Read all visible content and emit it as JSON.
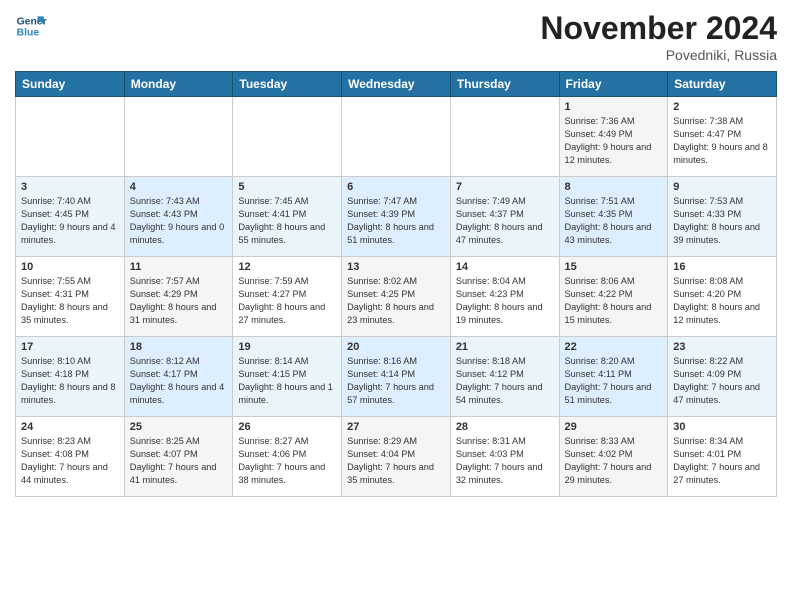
{
  "header": {
    "logo_line1": "General",
    "logo_line2": "Blue",
    "month": "November 2024",
    "location": "Povedniki, Russia"
  },
  "days_of_week": [
    "Sunday",
    "Monday",
    "Tuesday",
    "Wednesday",
    "Thursday",
    "Friday",
    "Saturday"
  ],
  "weeks": [
    [
      {
        "day": "",
        "info": ""
      },
      {
        "day": "",
        "info": ""
      },
      {
        "day": "",
        "info": ""
      },
      {
        "day": "",
        "info": ""
      },
      {
        "day": "",
        "info": ""
      },
      {
        "day": "1",
        "info": "Sunrise: 7:36 AM\nSunset: 4:49 PM\nDaylight: 9 hours and 12 minutes."
      },
      {
        "day": "2",
        "info": "Sunrise: 7:38 AM\nSunset: 4:47 PM\nDaylight: 9 hours and 8 minutes."
      }
    ],
    [
      {
        "day": "3",
        "info": "Sunrise: 7:40 AM\nSunset: 4:45 PM\nDaylight: 9 hours and 4 minutes."
      },
      {
        "day": "4",
        "info": "Sunrise: 7:43 AM\nSunset: 4:43 PM\nDaylight: 9 hours and 0 minutes."
      },
      {
        "day": "5",
        "info": "Sunrise: 7:45 AM\nSunset: 4:41 PM\nDaylight: 8 hours and 55 minutes."
      },
      {
        "day": "6",
        "info": "Sunrise: 7:47 AM\nSunset: 4:39 PM\nDaylight: 8 hours and 51 minutes."
      },
      {
        "day": "7",
        "info": "Sunrise: 7:49 AM\nSunset: 4:37 PM\nDaylight: 8 hours and 47 minutes."
      },
      {
        "day": "8",
        "info": "Sunrise: 7:51 AM\nSunset: 4:35 PM\nDaylight: 8 hours and 43 minutes."
      },
      {
        "day": "9",
        "info": "Sunrise: 7:53 AM\nSunset: 4:33 PM\nDaylight: 8 hours and 39 minutes."
      }
    ],
    [
      {
        "day": "10",
        "info": "Sunrise: 7:55 AM\nSunset: 4:31 PM\nDaylight: 8 hours and 35 minutes."
      },
      {
        "day": "11",
        "info": "Sunrise: 7:57 AM\nSunset: 4:29 PM\nDaylight: 8 hours and 31 minutes."
      },
      {
        "day": "12",
        "info": "Sunrise: 7:59 AM\nSunset: 4:27 PM\nDaylight: 8 hours and 27 minutes."
      },
      {
        "day": "13",
        "info": "Sunrise: 8:02 AM\nSunset: 4:25 PM\nDaylight: 8 hours and 23 minutes."
      },
      {
        "day": "14",
        "info": "Sunrise: 8:04 AM\nSunset: 4:23 PM\nDaylight: 8 hours and 19 minutes."
      },
      {
        "day": "15",
        "info": "Sunrise: 8:06 AM\nSunset: 4:22 PM\nDaylight: 8 hours and 15 minutes."
      },
      {
        "day": "16",
        "info": "Sunrise: 8:08 AM\nSunset: 4:20 PM\nDaylight: 8 hours and 12 minutes."
      }
    ],
    [
      {
        "day": "17",
        "info": "Sunrise: 8:10 AM\nSunset: 4:18 PM\nDaylight: 8 hours and 8 minutes."
      },
      {
        "day": "18",
        "info": "Sunrise: 8:12 AM\nSunset: 4:17 PM\nDaylight: 8 hours and 4 minutes."
      },
      {
        "day": "19",
        "info": "Sunrise: 8:14 AM\nSunset: 4:15 PM\nDaylight: 8 hours and 1 minute."
      },
      {
        "day": "20",
        "info": "Sunrise: 8:16 AM\nSunset: 4:14 PM\nDaylight: 7 hours and 57 minutes."
      },
      {
        "day": "21",
        "info": "Sunrise: 8:18 AM\nSunset: 4:12 PM\nDaylight: 7 hours and 54 minutes."
      },
      {
        "day": "22",
        "info": "Sunrise: 8:20 AM\nSunset: 4:11 PM\nDaylight: 7 hours and 51 minutes."
      },
      {
        "day": "23",
        "info": "Sunrise: 8:22 AM\nSunset: 4:09 PM\nDaylight: 7 hours and 47 minutes."
      }
    ],
    [
      {
        "day": "24",
        "info": "Sunrise: 8:23 AM\nSunset: 4:08 PM\nDaylight: 7 hours and 44 minutes."
      },
      {
        "day": "25",
        "info": "Sunrise: 8:25 AM\nSunset: 4:07 PM\nDaylight: 7 hours and 41 minutes."
      },
      {
        "day": "26",
        "info": "Sunrise: 8:27 AM\nSunset: 4:06 PM\nDaylight: 7 hours and 38 minutes."
      },
      {
        "day": "27",
        "info": "Sunrise: 8:29 AM\nSunset: 4:04 PM\nDaylight: 7 hours and 35 minutes."
      },
      {
        "day": "28",
        "info": "Sunrise: 8:31 AM\nSunset: 4:03 PM\nDaylight: 7 hours and 32 minutes."
      },
      {
        "day": "29",
        "info": "Sunrise: 8:33 AM\nSunset: 4:02 PM\nDaylight: 7 hours and 29 minutes."
      },
      {
        "day": "30",
        "info": "Sunrise: 8:34 AM\nSunset: 4:01 PM\nDaylight: 7 hours and 27 minutes."
      }
    ]
  ]
}
